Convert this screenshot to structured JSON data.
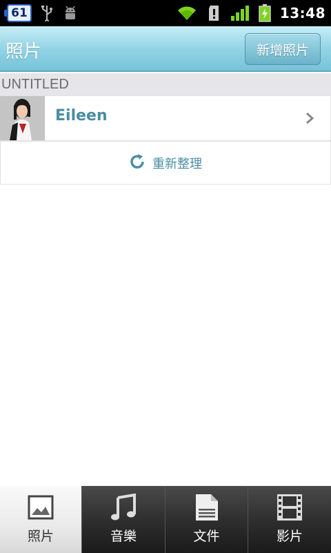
{
  "status_bar": {
    "notification_count": "61",
    "time": "13:48",
    "icons": [
      "notification-badge-icon",
      "usb-icon",
      "android-debug-icon",
      "wifi-icon",
      "sd-card-icon",
      "signal-icon",
      "battery-charging-icon"
    ]
  },
  "header": {
    "title": "照片",
    "add_button_label": "新增照片"
  },
  "section": {
    "title": "UNTITLED"
  },
  "albums": [
    {
      "name": "Eileen"
    }
  ],
  "refresh": {
    "label": "重新整理"
  },
  "tabs": [
    {
      "label": "照片",
      "icon": "photo-icon",
      "selected": true
    },
    {
      "label": "音樂",
      "icon": "music-icon",
      "selected": false
    },
    {
      "label": "文件",
      "icon": "document-icon",
      "selected": false
    },
    {
      "label": "影片",
      "icon": "film-icon",
      "selected": false
    }
  ],
  "colors": {
    "accent_text": "#4a8ea3",
    "header_top": "#c6edf6",
    "header_bottom": "#78c3d8"
  }
}
